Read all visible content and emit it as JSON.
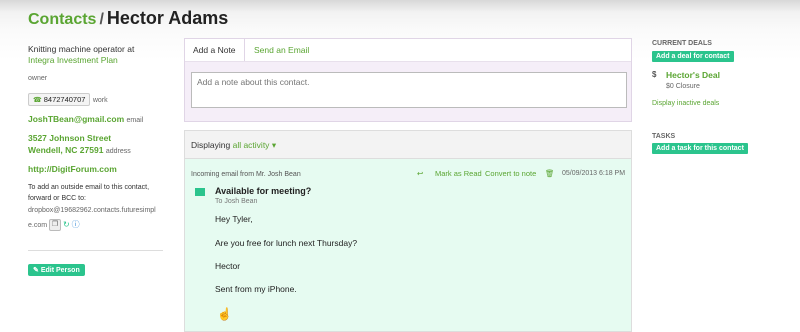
{
  "header": {
    "breadcrumb": "Contacts",
    "separator": "/",
    "title": "Hector Adams"
  },
  "contact": {
    "job_title": "Knitting machine operator at",
    "company": "Integra Investment Plan",
    "role": "owner",
    "phone": "8472740707",
    "phone_type": "work",
    "email": "JoshTBean@gmail.com",
    "email_type": "email",
    "address_line1": "3527 Johnson Street",
    "address_line2": "Wendell, NC 27591",
    "address_type": "address",
    "website": "http://DigitForum.com",
    "forward_text_1": "To add an outside email to this contact,",
    "forward_text_2": "forward or BCC to:",
    "dropbox_1": "dropbox@19682962.contacts.futuresimpl",
    "dropbox_2": "e.com",
    "edit_button": "Edit Person"
  },
  "tabs": [
    {
      "label": "Add a Note",
      "active": true
    },
    {
      "label": "Send an Email",
      "active": false
    }
  ],
  "note": {
    "placeholder": "Add a note about this contact."
  },
  "activity": {
    "displaying_label": "Displaying",
    "filter": "all activity",
    "email_meta": "Incoming email from Mr. Josh Bean",
    "mark_as_read": "Mark as Read",
    "convert_to_note": "Convert to note",
    "timestamp": "05/09/2013 6:18 PM",
    "subject": "Available for meeting?",
    "to": "To Josh Bean",
    "body": [
      "Hey Tyler,",
      "Are you free for lunch next Thursday?",
      "Hector",
      "Sent from my iPhone."
    ]
  },
  "right": {
    "current_deals": "CURRENT DEALS",
    "add_deal": "Add a deal for contact",
    "deal_currency": "$",
    "deal_name": "Hector's Deal",
    "deal_sub": "$0 Closure",
    "display_inactive": "Display inactive deals",
    "tasks": "TASKS",
    "add_task": "Add a task for this contact"
  },
  "colors": {
    "accent_green": "#5aa532",
    "button_teal": "#2bc48d",
    "email_bg": "#e6fbf1"
  }
}
